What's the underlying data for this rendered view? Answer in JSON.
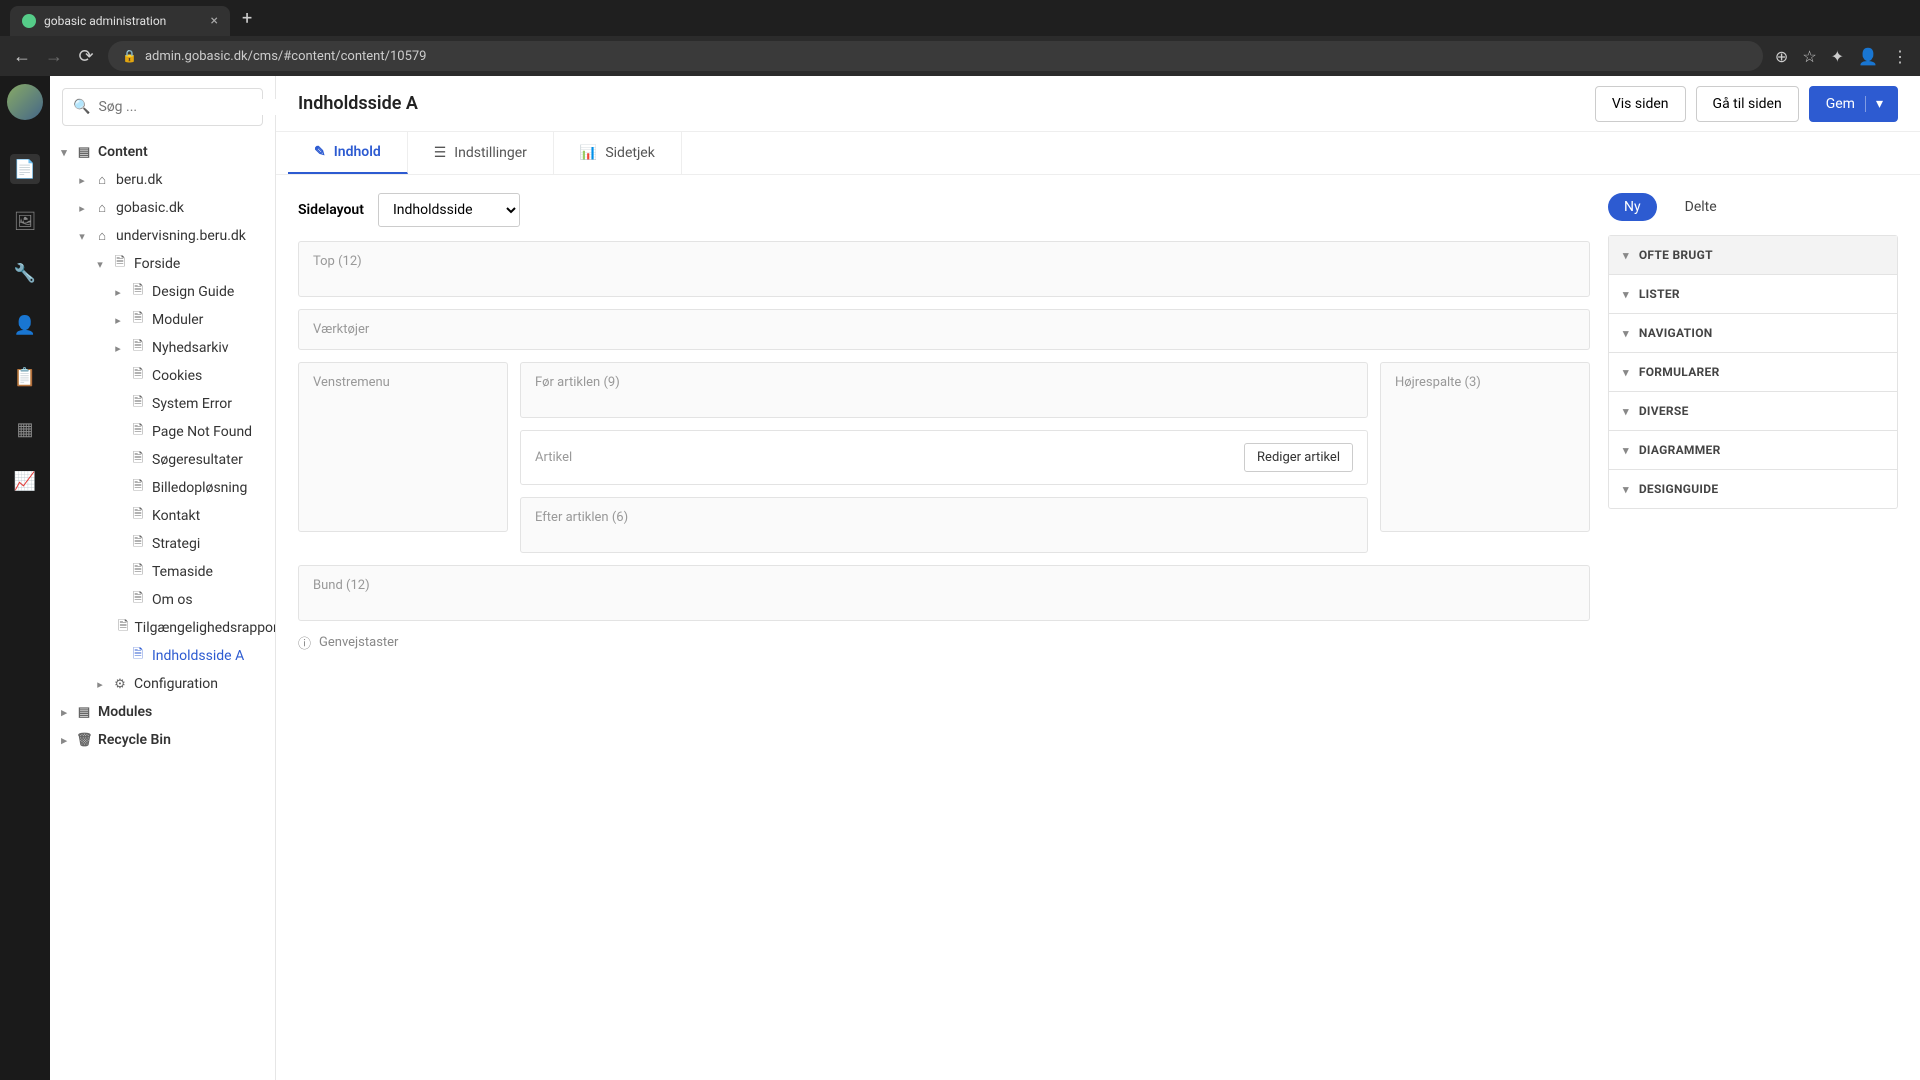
{
  "browser": {
    "tab_title": "gobasic administration",
    "url": "admin.gobasic.dk/cms/#content/content/10579"
  },
  "search": {
    "placeholder": "Søg ..."
  },
  "tree": {
    "content": "Content",
    "beru": "beru.dk",
    "gobasic": "gobasic.dk",
    "undervisning": "undervisning.beru.dk",
    "forside": "Forside",
    "design_guide": "Design Guide",
    "moduler": "Moduler",
    "nyhedsarkiv": "Nyhedsarkiv",
    "cookies": "Cookies",
    "system_error": "System Error",
    "page_not_found": "Page Not Found",
    "sogeresultater": "Søgeresultater",
    "billedoplosning": "Billedopløsning",
    "kontakt": "Kontakt",
    "strategi": "Strategi",
    "temaside": "Temaside",
    "om_os": "Om os",
    "tilg": "Tilgængelighedsrapport",
    "indholdsside_a": "Indholdsside A",
    "configuration": "Configuration",
    "modules": "Modules",
    "recycle": "Recycle Bin"
  },
  "page": {
    "title": "Indholdsside A",
    "actions": {
      "view": "Vis siden",
      "goto": "Gå til siden",
      "save": "Gem"
    },
    "tabs": {
      "content": "Indhold",
      "settings": "Indstillinger",
      "check": "Sidetjek"
    }
  },
  "layout": {
    "label": "Sidelayout",
    "selected": "Indholdsside",
    "zones": {
      "top": "Top (12)",
      "tools": "Værktøjer",
      "leftmenu": "Venstremenu",
      "before": "Før artiklen (9)",
      "article": "Artikel",
      "edit_article": "Rediger artikel",
      "after": "Efter artiklen (6)",
      "rightcol": "Højrespalte (3)",
      "bottom": "Bund (12)"
    },
    "shortcuts": "Genvejstaster"
  },
  "widgets": {
    "ny": "Ny",
    "delte": "Delte",
    "groups": {
      "ofte": "OFTE BRUGT",
      "lister": "LISTER",
      "navigation": "NAVIGATION",
      "formularer": "FORMULARER",
      "diverse": "DIVERSE",
      "diagrammer": "DIAGRAMMER",
      "designguide": "DESIGNGUIDE"
    }
  }
}
